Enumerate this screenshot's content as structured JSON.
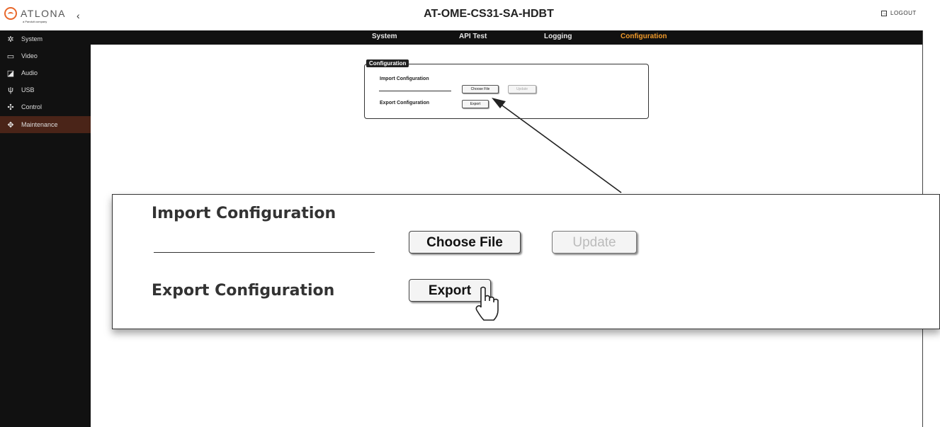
{
  "header": {
    "logo_text": "ATLONA",
    "logo_sub": "a Panduit company",
    "collapse_glyph": "‹",
    "title": "AT-OME-CS31-SA-HDBT",
    "logout_label": "LOGOUT"
  },
  "sidebar": {
    "items": [
      {
        "label": "System",
        "icon": "gear-icon"
      },
      {
        "label": "Video",
        "icon": "monitor-icon"
      },
      {
        "label": "Audio",
        "icon": "audio-icon"
      },
      {
        "label": "USB",
        "icon": "usb-icon"
      },
      {
        "label": "Control",
        "icon": "control-icon"
      },
      {
        "label": "Maintenance",
        "icon": "maintenance-icon"
      }
    ],
    "active": "Maintenance"
  },
  "tabs": {
    "items": [
      "System",
      "API Test",
      "Logging",
      "Configuration"
    ],
    "active": "Configuration"
  },
  "config": {
    "legend": "Configuration",
    "import_label": "Import Configuration",
    "choose_file": "Choose File",
    "update": "Update",
    "export_label": "Export Configuration",
    "export": "Export"
  },
  "colors": {
    "accent": "#f19a2a",
    "sidebar_bg": "#111111",
    "sidebar_active": "#4a2418",
    "logo": "#e8672a"
  }
}
